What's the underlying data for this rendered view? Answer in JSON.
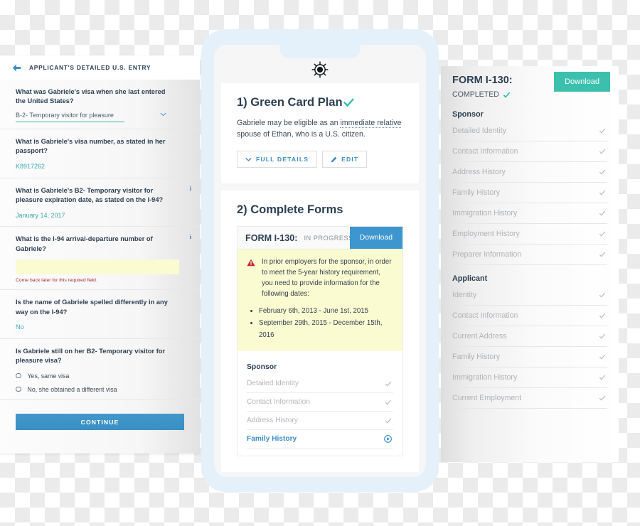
{
  "left_panel": {
    "header": {
      "back_icon": "back-arrow-icon",
      "title": "APPLICANT'S DETAILED U.S. ENTRY"
    },
    "questions": [
      {
        "text": "What was Gabriele's visa when she last entered the United States?",
        "type": "select",
        "value": "B-2- Temporary visitor for pleasure",
        "chevron_icon": "chevron-down-icon"
      },
      {
        "text": "What is Gabriele's visa number, as stated in her passport?",
        "type": "answer",
        "value": "K8917262"
      },
      {
        "text": "What is Gabriele's B2- Temporary visitor for pleasure expiration date, as stated on the I-94?",
        "type": "answer",
        "value": "January 14, 2017",
        "info_icon": "info-icon"
      },
      {
        "text": "What is the I-94 arrival-departure number of Gabriele?",
        "type": "input",
        "value": "",
        "error": "Come back later for this required field.",
        "info_icon": "info-icon"
      },
      {
        "text": "Is the name of Gabriele spelled differently in any way on the I-94?",
        "type": "answer",
        "value": "No"
      },
      {
        "text": "Is Gabriele still on her B2- Temporary visitor for pleasure visa?",
        "type": "radio",
        "options": [
          "Yes, same visa",
          "No, she obtained a different visa"
        ]
      }
    ],
    "continue_label": "CONTINUE"
  },
  "phone": {
    "logo_icon": "ships-wheel-logo-icon",
    "plan_card": {
      "title": "1) Green Card Plan",
      "title_check_icon": "check-icon",
      "description_pre": "Gabriele may be eligible as an ",
      "description_link": "immediate relative",
      "description_post": " spouse of Ethan, who is a U.S. citizen.",
      "full_details_label": "FULL DETAILS",
      "full_details_icon": "chevron-down-icon",
      "edit_label": "EDIT",
      "edit_icon": "pencil-icon"
    },
    "forms_card": {
      "title": "2) Complete Forms",
      "form_name": "FORM I-130:",
      "form_status": "IN PROGRESS",
      "download_label": "Download",
      "alert": {
        "icon": "warning-triangle-icon",
        "text": "In prior employers for the sponsor, in order to meet the 5-year history requirement, you need to provide information for the following dates:",
        "items": [
          "February 6th, 2013 - June 1st, 2015",
          "September 29th, 2015 - December 15th, 2016"
        ]
      },
      "sponsor_heading": "Sponsor",
      "sponsor_rows": [
        {
          "label": "Detailed Identity",
          "icon": "check-icon",
          "state": "done"
        },
        {
          "label": "Contact Information",
          "icon": "check-icon",
          "state": "done"
        },
        {
          "label": "Address History",
          "icon": "check-icon",
          "state": "done"
        },
        {
          "label": "Family History",
          "icon": "play-circle-icon",
          "state": "active"
        }
      ]
    }
  },
  "right_panel": {
    "form_name": "FORM I-130:",
    "status_label": "COMPLETED",
    "status_check_icon": "check-icon",
    "download_label": "Download",
    "sections": [
      {
        "heading": "Sponsor",
        "rows": [
          {
            "label": "Detailed Identity",
            "icon": "check-icon"
          },
          {
            "label": "Contact Information",
            "icon": "check-icon"
          },
          {
            "label": "Address History",
            "icon": "check-icon"
          },
          {
            "label": "Family History",
            "icon": "check-icon"
          },
          {
            "label": "Immigration History",
            "icon": "check-icon"
          },
          {
            "label": "Employment History",
            "icon": "check-icon"
          },
          {
            "label": "Preparer Information",
            "icon": "check-icon"
          }
        ]
      },
      {
        "heading": "Applicant",
        "rows": [
          {
            "label": "Identity",
            "icon": "check-icon"
          },
          {
            "label": "Contact Information",
            "icon": "check-icon"
          },
          {
            "label": "Current Address",
            "icon": "check-icon"
          },
          {
            "label": "Family History",
            "icon": "check-icon"
          },
          {
            "label": "Immigration History",
            "icon": "check-icon"
          },
          {
            "label": "Current Employment",
            "icon": "check-icon"
          }
        ]
      }
    ]
  },
  "colors": {
    "teal": "#3cc0ae",
    "blue": "#3d96cf",
    "dark_navy": "#2b3f54",
    "alert_yellow": "#fbfbd2",
    "error_red": "#a32633",
    "phone_frame": "#e4f1fb"
  }
}
